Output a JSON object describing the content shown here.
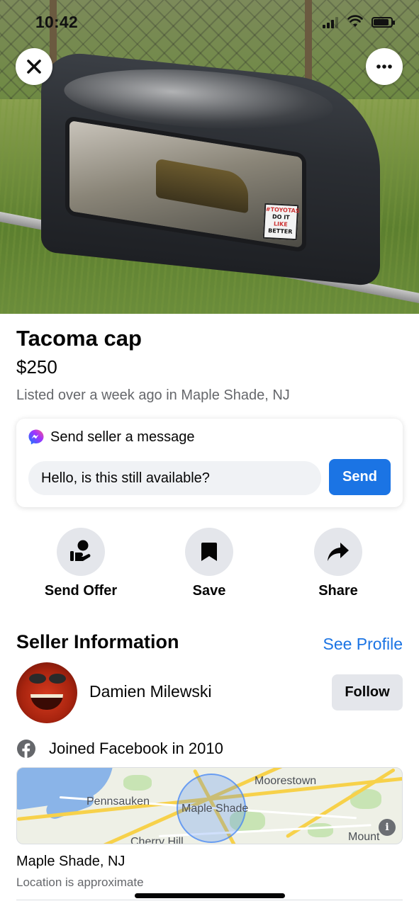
{
  "status_bar": {
    "time": "10:42"
  },
  "photo": {
    "sticker_lines": [
      "#TOYOTAS",
      "DO IT",
      "LIKE",
      "BETTER"
    ]
  },
  "listing": {
    "title": "Tacoma cap",
    "price": "$250",
    "meta": "Listed over a week ago in Maple Shade, NJ"
  },
  "message": {
    "header": "Send seller a message",
    "input_value": "Hello, is this still available?",
    "send_label": "Send"
  },
  "actions": [
    {
      "label": "Send Offer",
      "icon": "offer-hand-icon"
    },
    {
      "label": "Save",
      "icon": "bookmark-icon"
    },
    {
      "label": "Share",
      "icon": "share-arrow-icon"
    }
  ],
  "seller": {
    "section_title": "Seller Information",
    "see_profile": "See Profile",
    "name": "Damien Milewski",
    "follow_label": "Follow",
    "joined": "Joined Facebook in 2010"
  },
  "map": {
    "labels": [
      "Moorestown",
      "Pennsauken",
      "Maple Shade",
      "Cherry Hill",
      "Mount"
    ]
  },
  "location": {
    "name": "Maple Shade, NJ",
    "note": "Location is approximate"
  },
  "colors": {
    "accent": "#1b74e4",
    "secondary_text": "#65676b",
    "button_gray": "#e4e6eb"
  }
}
